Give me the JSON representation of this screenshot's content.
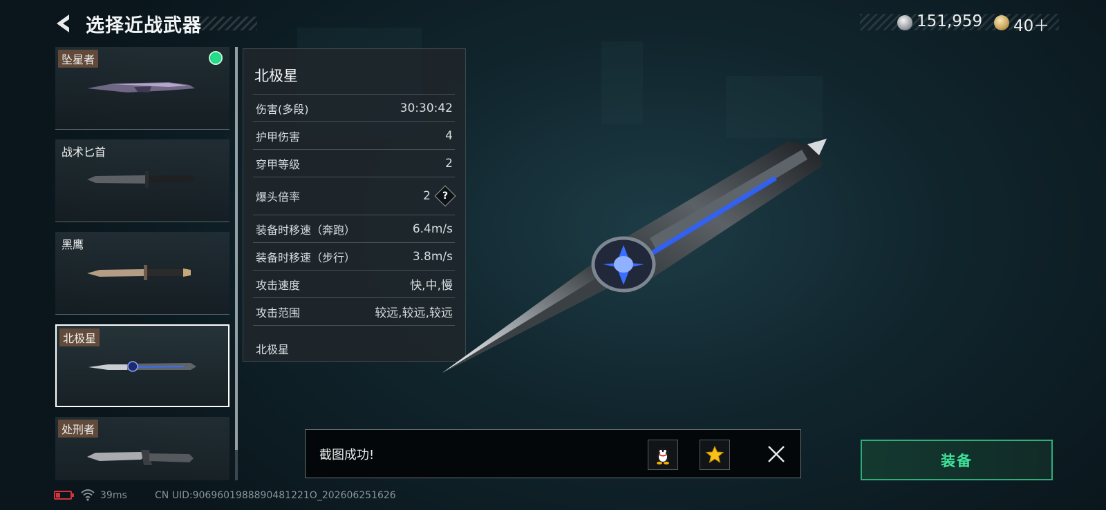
{
  "header": {
    "title": "选择近战武器"
  },
  "currency": {
    "silver_value": "151,959",
    "gold_value": "40＋"
  },
  "weapons": [
    {
      "name": "坠星者",
      "tagged": true,
      "equipped": true,
      "selected": false
    },
    {
      "name": "战术匕首",
      "tagged": false,
      "equipped": false,
      "selected": false
    },
    {
      "name": "黑鹰",
      "tagged": false,
      "equipped": false,
      "selected": false
    },
    {
      "name": "北极星",
      "tagged": true,
      "equipped": false,
      "selected": true
    },
    {
      "name": "处刑者",
      "tagged": true,
      "equipped": false,
      "selected": false
    }
  ],
  "stats": {
    "name": "北极星",
    "rows": [
      {
        "label": "伤害(多段)",
        "value": "30:30:42"
      },
      {
        "label": "护甲伤害",
        "value": "4"
      },
      {
        "label": "穿甲等级",
        "value": "2"
      },
      {
        "label": "爆头倍率",
        "value": "2",
        "help": "?"
      },
      {
        "label": "装备时移速（奔跑）",
        "value": "6.4m/s"
      },
      {
        "label": "装备时移速（步行）",
        "value": "3.8m/s"
      },
      {
        "label": "攻击速度",
        "value": "快,中,慢"
      },
      {
        "label": "攻击范围",
        "value": "较远,较远,较远"
      }
    ],
    "footer": "北极星"
  },
  "toast": {
    "message": "截图成功!"
  },
  "equip_button": {
    "label": "装备"
  },
  "status_bar": {
    "ping": "39ms",
    "uid": "CN UID:9069601988890481221O_202606251626"
  },
  "colors": {
    "accent_green": "#3fe39a",
    "equipped_dot": "#22e08a",
    "battery_low": "#d8323a"
  }
}
